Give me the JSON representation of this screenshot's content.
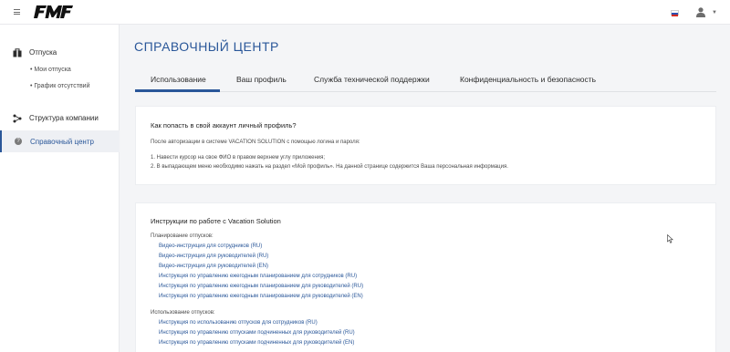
{
  "app": {
    "logo_text": "FMF",
    "language_flag": "ru",
    "colors": {
      "accent": "#2a5799",
      "sidebar_bg": "#ffffff",
      "page_bg": "#f4f5f7"
    }
  },
  "sidebar": {
    "vacations": {
      "label": "Отпуска",
      "items": [
        "• Мои отпуска",
        "• График отсутствий"
      ]
    },
    "company": {
      "label": "Структура компании"
    },
    "help": {
      "label": "Справочный центр"
    }
  },
  "main": {
    "title": "СПРАВОЧНЫЙ ЦЕНТР",
    "tabs": [
      {
        "label": "Использование",
        "active": true
      },
      {
        "label": "Ваш профиль",
        "active": false
      },
      {
        "label": "Служба технической поддержки",
        "active": false
      },
      {
        "label": "Конфиденциальность и безопасность",
        "active": false
      }
    ],
    "card1": {
      "title": "Как попасть в свой аккаунт личный профиль?",
      "intro": "После авторизации в системе VACATION SOLUTION с помощью логина и пароля:",
      "steps": [
        "1. Навести курсор на свое ФИО в правом верхнем углу приложения;",
        "2. В выпадающем меню необходимо нажать на раздел «Мой профиль». На данной странице содержится Ваша персональная информация."
      ]
    },
    "card2": {
      "title": "Инструкции по работе с Vacation Solution",
      "planning_label": "Планирование отпусков:",
      "planning_links": [
        "Видео-инструкция для сотрудников (RU)",
        "Видео-инструкция для руководителей (RU)",
        "Видео-инструкция для руководителей (EN)",
        "Инструкция по управлению ежегодным планированием для сотрудников (RU)",
        "Инструкция по управлению ежегодным планированием для руководителей (RU)",
        "Инструкция по управлению ежегодным планированием для руководителей (EN)"
      ],
      "usage_label": "Использование отпусков:",
      "usage_links": [
        "Инструкция по использованию отпусков для сотрудников (RU)",
        "Инструкция по управлению отпусками подчиненных для руководителей (RU)",
        "Инструкция по управлению отпусками подчиненных для руководителей (EN)"
      ]
    }
  }
}
